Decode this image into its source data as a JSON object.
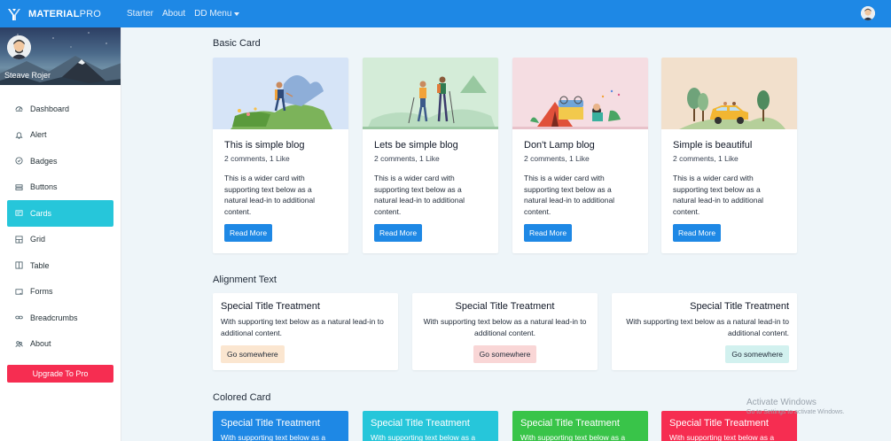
{
  "header": {
    "brand_bold": "MATERIAL",
    "brand_light": "PRO",
    "nav": [
      "Starter",
      "About",
      "DD Menu"
    ],
    "accent": "#1e88e5"
  },
  "sidebar": {
    "user_name": "Steave Rojer",
    "items": [
      {
        "label": "Dashboard",
        "icon": "dashboard-icon"
      },
      {
        "label": "Alert",
        "icon": "bell-icon"
      },
      {
        "label": "Badges",
        "icon": "badge-icon"
      },
      {
        "label": "Buttons",
        "icon": "buttons-icon"
      },
      {
        "label": "Cards",
        "icon": "cards-icon",
        "active": true
      },
      {
        "label": "Grid",
        "icon": "grid-icon"
      },
      {
        "label": "Table",
        "icon": "table-icon"
      },
      {
        "label": "Forms",
        "icon": "forms-icon"
      },
      {
        "label": "Breadcrumbs",
        "icon": "link-icon"
      },
      {
        "label": "About",
        "icon": "users-icon"
      }
    ],
    "upgrade_label": "Upgrade To Pro",
    "active_color": "#26c6da",
    "upgrade_color": "#f62d51"
  },
  "basic": {
    "title": "Basic Card",
    "cards": [
      {
        "title": "This is simple blog",
        "sub": "2 comments, 1 Like",
        "text": "This is a wider card with supporting text below as a natural lead-in to additional content.",
        "button": "Read More"
      },
      {
        "title": "Lets be simple blog",
        "sub": "2 comments, 1 Like",
        "text": "This is a wider card with supporting text below as a natural lead-in to additional content.",
        "button": "Read More"
      },
      {
        "title": "Don't Lamp blog",
        "sub": "2 comments, 1 Like",
        "text": "This is a wider card with supporting text below as a natural lead-in to additional content.",
        "button": "Read More"
      },
      {
        "title": "Simple is beautiful",
        "sub": "2 comments, 1 Like",
        "text": "This is a wider card with supporting text below as a natural lead-in to additional content.",
        "button": "Read More"
      }
    ]
  },
  "alignment": {
    "title": "Alignment Text",
    "cards": [
      {
        "title": "Special Title Treatment",
        "text": "With supporting text below as a natural lead-in to additional content.",
        "button": "Go somewhere",
        "align": "left"
      },
      {
        "title": "Special Title Treatment",
        "text": "With supporting text below as a natural lead-in to additional content.",
        "button": "Go somewhere",
        "align": "center"
      },
      {
        "title": "Special Title Treatment",
        "text": "With supporting text below as a natural lead-in to additional content.",
        "button": "Go somewhere",
        "align": "right"
      }
    ]
  },
  "colored": {
    "title": "Colored Card",
    "cards": [
      {
        "title": "Special Title Treatment",
        "text": "With supporting text below as a",
        "color": "#1e88e5"
      },
      {
        "title": "Special Title Treatment",
        "text": "With supporting text below as a",
        "color": "#26c6da"
      },
      {
        "title": "Special Title Treatment",
        "text": "With supporting text below as a",
        "color": "#39c449"
      },
      {
        "title": "Special Title Treatment",
        "text": "With supporting text below as a",
        "color": "#f62d51"
      }
    ]
  },
  "watermark": {
    "line1": "Activate Windows",
    "line2": "Go to Settings to activate Windows."
  }
}
